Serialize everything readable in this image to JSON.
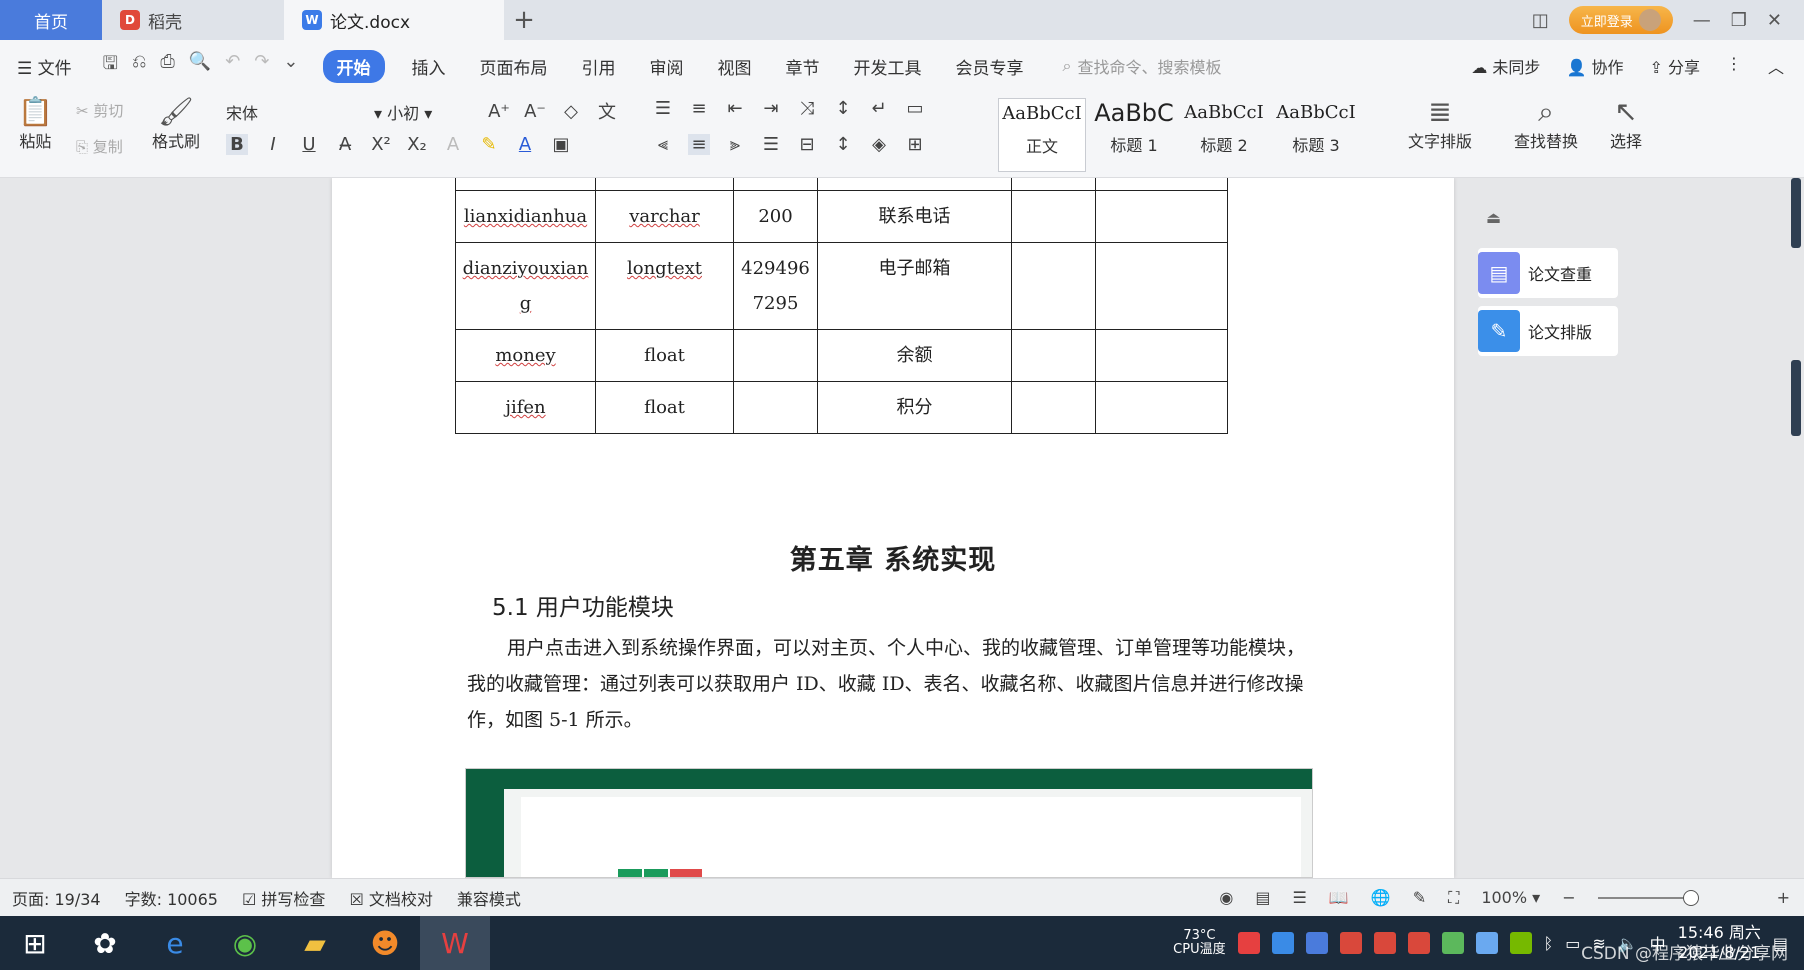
{
  "tabs": {
    "home": "首页",
    "daoke": "稻壳",
    "doc": "论文.docx"
  },
  "titlebar": {
    "login": "立即登录"
  },
  "menu": {
    "file": "文件",
    "items": [
      "开始",
      "插入",
      "页面布局",
      "引用",
      "审阅",
      "视图",
      "章节",
      "开发工具",
      "会员专享"
    ],
    "search": "查找命令、搜索模板",
    "unsync": "未同步",
    "collab": "协作",
    "share": "分享"
  },
  "ribbon": {
    "paste": "粘贴",
    "cut": "剪切",
    "copy": "复制",
    "format_painter": "格式刷",
    "font_name": "宋体",
    "font_size": "小初",
    "styles": [
      {
        "preview": "AaBbCcI",
        "label": "正文"
      },
      {
        "preview": "AaBbC",
        "label": "标题 1"
      },
      {
        "preview": "AaBbCcI",
        "label": "标题 2"
      },
      {
        "preview": "AaBbCcI",
        "label": "标题 3"
      }
    ],
    "text_layout": "文字排版",
    "find_replace": "查找替换",
    "select": "选择"
  },
  "table_rows": [
    {
      "field": "lianxidianhua",
      "type": "varchar",
      "len": "200",
      "desc": "联系电话"
    },
    {
      "field": "dianziyouxiang",
      "type": "longtext",
      "len": "4294967295",
      "desc": "电子邮箱"
    },
    {
      "field": "money",
      "type": "float",
      "len": "",
      "desc": "余额"
    },
    {
      "field": "jifen",
      "type": "float",
      "len": "",
      "desc": "积分"
    }
  ],
  "content": {
    "chapter": "第五章  系统实现",
    "section": "5.1 用户功能模块",
    "paragraph": "用户点击进入到系统操作界面，可以对主页、个人中心、我的收藏管理、订单管理等功能模块，我的收藏管理：通过列表可以获取用户 ID、收藏 ID、表名、收藏名称、收藏图片信息并进行修改操作，如图 5-1 所示。"
  },
  "sidepanel": {
    "check": "论文查重",
    "layout": "论文排版"
  },
  "status": {
    "page": "页面: 19/34",
    "words": "字数: 10065",
    "spell": "拼写检查",
    "proof": "文档校对",
    "compat": "兼容模式",
    "zoom": "100%"
  },
  "taskbar": {
    "cpu_temp": "73°C",
    "cpu_label": "CPU温度",
    "time": "15:46 周六",
    "date": "2021/8/21",
    "watermark": "CSDN @程序猿毕业分享网"
  },
  "colors": {
    "accent": "#3e78e6",
    "home_tab": "#4a7bdc",
    "taskbar": "#1b2a3a"
  }
}
